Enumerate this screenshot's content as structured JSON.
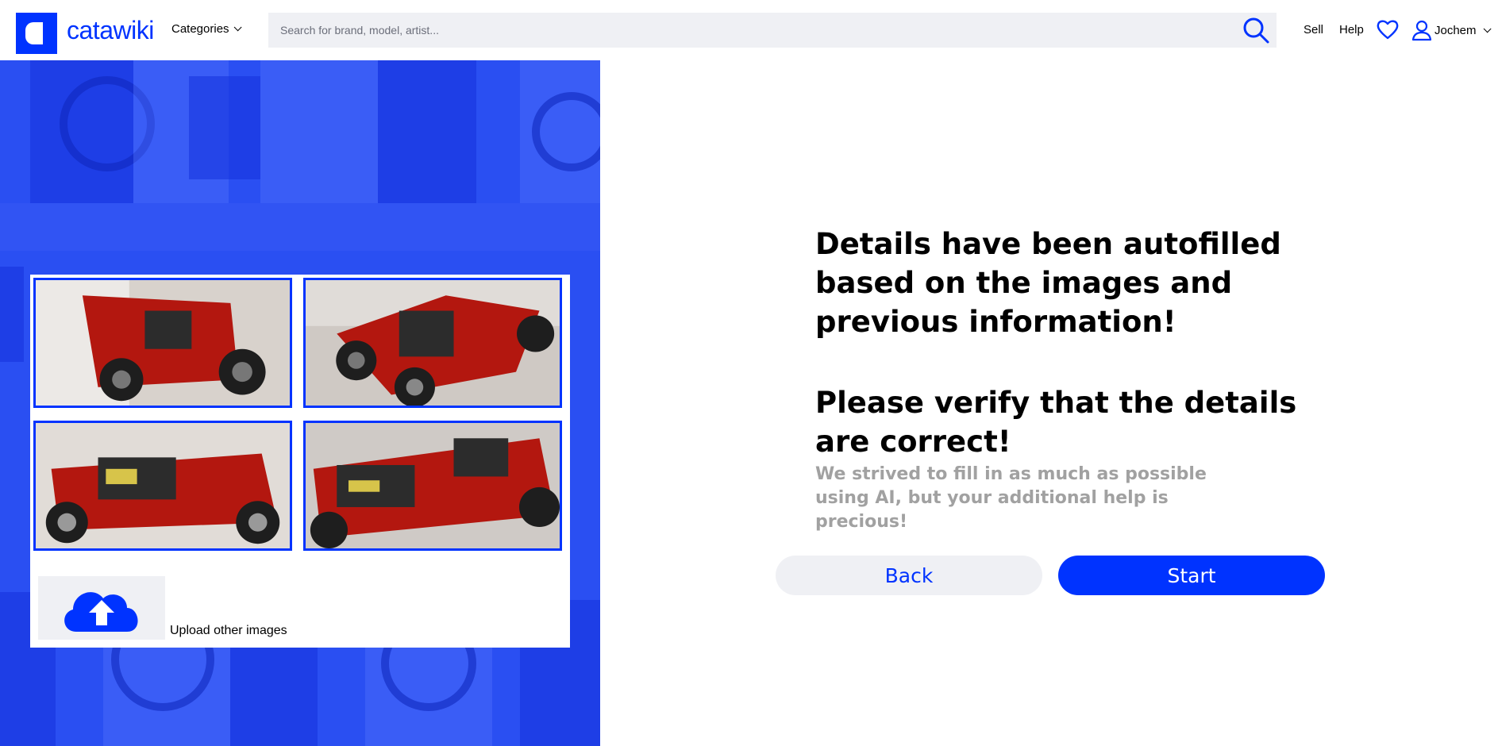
{
  "brand": {
    "name": "catawiki",
    "accent": "#0033ff"
  },
  "header": {
    "categories_label": "Categories",
    "search_placeholder": "Search for brand, model, artist...",
    "sell_label": "Sell",
    "help_label": "Help",
    "user_name": "Jochem"
  },
  "gallery": {
    "images": [
      {
        "alt": "Red Technic hot rod car, front view"
      },
      {
        "alt": "Red Technic hot rod car, front three-quarter view"
      },
      {
        "alt": "Red Technic hot rod car, side view"
      },
      {
        "alt": "Red Technic hot rod car, rear three-quarter view"
      }
    ],
    "upload_label": "Upload other images"
  },
  "content": {
    "heading1": "Details have been autofilled based on the images and previous information!",
    "heading2": "Please verify that the details are correct!",
    "subtext": "We strived to fill in as much as possible using AI, but your additional help is precious!"
  },
  "actions": {
    "back_label": "Back",
    "start_label": "Start"
  }
}
